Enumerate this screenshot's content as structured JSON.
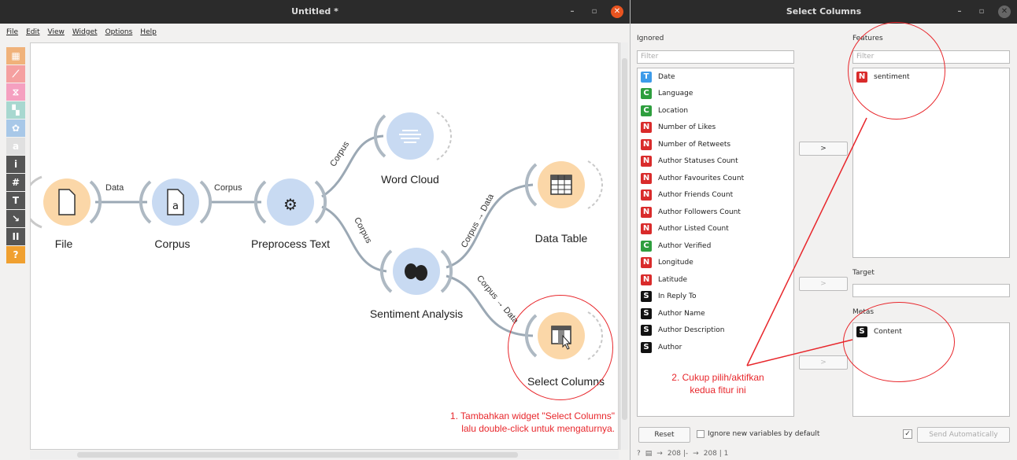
{
  "main_window": {
    "title": "Untitled *",
    "menu": [
      "File",
      "Edit",
      "View",
      "Widget",
      "Options",
      "Help"
    ],
    "toolbox": [
      {
        "name": "data-category-icon",
        "glyph": "▦",
        "color": "#f0b27a"
      },
      {
        "name": "visualize-category-icon",
        "glyph": "⟋",
        "color": "#f5a0a0"
      },
      {
        "name": "model-category-icon",
        "glyph": "⧖",
        "color": "#f5a0c0"
      },
      {
        "name": "evaluate-category-icon",
        "glyph": "▚",
        "color": "#a8d8d0"
      },
      {
        "name": "unsupervised-category-icon",
        "glyph": "✿",
        "color": "#a8c8e8"
      },
      {
        "name": "text-mining-category-icon",
        "glyph": "a",
        "color": "#e0e0e0"
      },
      {
        "name": "info-icon",
        "glyph": "i",
        "color": "#555"
      },
      {
        "name": "hash-icon",
        "glyph": "#",
        "color": "#555"
      },
      {
        "name": "text-icon",
        "glyph": "T",
        "color": "#555"
      },
      {
        "name": "arrow-icon",
        "glyph": "↘",
        "color": "#555"
      },
      {
        "name": "pause-icon",
        "glyph": "II",
        "color": "#555"
      },
      {
        "name": "help-icon",
        "glyph": "?",
        "color": "#f0a030"
      }
    ],
    "widgets": {
      "file": "File",
      "corpus": "Corpus",
      "preprocess": "Preprocess Text",
      "wordcloud": "Word Cloud",
      "sentiment": "Sentiment Analysis",
      "datatable": "Data Table",
      "selectcolumns": "Select Columns"
    },
    "links": {
      "file_corpus": "Data",
      "corpus_preprocess": "Corpus",
      "preprocess_wordcloud": "Corpus",
      "preprocess_sentiment": "Corpus",
      "sentiment_datatable": "Corpus → Data",
      "sentiment_selectcolumns": "Corpus → Data"
    },
    "annotation": {
      "line1": "1. Tambahkan widget \"Select Columns\"",
      "line2": "lalu double-click untuk mengaturnya."
    }
  },
  "select_columns": {
    "title": "Select Columns",
    "ignored_label": "Ignored",
    "features_label": "Features",
    "target_label": "Target",
    "metas_label": "Metas",
    "filter_placeholder": "Filter",
    "ignored": [
      {
        "type": "T",
        "label": "Date",
        "color": "#3d9be9"
      },
      {
        "type": "C",
        "label": "Language",
        "color": "#2e9e3e"
      },
      {
        "type": "C",
        "label": "Location",
        "color": "#2e9e3e"
      },
      {
        "type": "N",
        "label": "Number of Likes",
        "color": "#d92b2b"
      },
      {
        "type": "N",
        "label": "Number of Retweets",
        "color": "#d92b2b"
      },
      {
        "type": "N",
        "label": "Author Statuses Count",
        "color": "#d92b2b"
      },
      {
        "type": "N",
        "label": "Author Favourites Count",
        "color": "#d92b2b"
      },
      {
        "type": "N",
        "label": "Author Friends Count",
        "color": "#d92b2b"
      },
      {
        "type": "N",
        "label": "Author Followers Count",
        "color": "#d92b2b"
      },
      {
        "type": "N",
        "label": "Author Listed Count",
        "color": "#d92b2b"
      },
      {
        "type": "C",
        "label": "Author Verified",
        "color": "#2e9e3e"
      },
      {
        "type": "N",
        "label": "Longitude",
        "color": "#d92b2b"
      },
      {
        "type": "N",
        "label": "Latitude",
        "color": "#d92b2b"
      },
      {
        "type": "S",
        "label": "In Reply To",
        "color": "#111"
      },
      {
        "type": "S",
        "label": "Author Name",
        "color": "#111"
      },
      {
        "type": "S",
        "label": "Author Description",
        "color": "#111"
      },
      {
        "type": "S",
        "label": "Author",
        "color": "#111"
      }
    ],
    "features": [
      {
        "type": "N",
        "label": "sentiment",
        "color": "#d92b2b"
      }
    ],
    "metas": [
      {
        "type": "S",
        "label": "Content",
        "color": "#111"
      }
    ],
    "move_button": ">",
    "reset_label": "Reset",
    "ignore_new_label": "Ignore new variables by default",
    "send_auto_label": "Send Automatically",
    "send_auto_checked": "✓",
    "status": {
      "in": "208 |-",
      "out": "208 | 1"
    },
    "annotation": {
      "line1": "2. Cukup pilih/aktifkan",
      "line2": "kedua fitur ini"
    }
  }
}
